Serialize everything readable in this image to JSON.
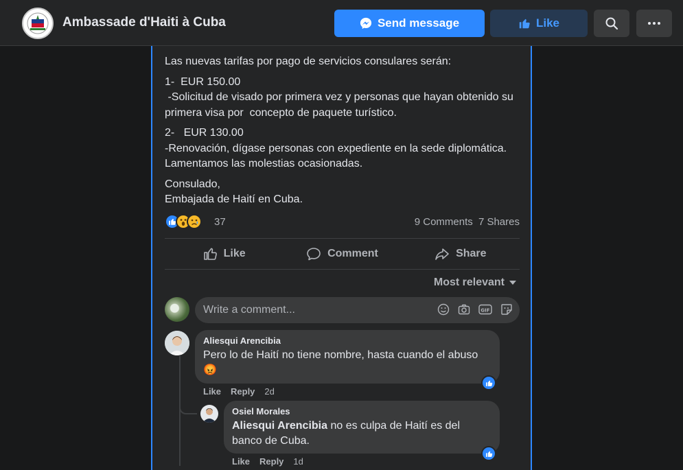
{
  "header": {
    "page_name": "Ambassade d'Haiti à Cuba",
    "send_message_label": "Send message",
    "like_label": "Like",
    "icons": [
      "messenger-icon",
      "thumbs-up-icon",
      "search-icon",
      "more-icon"
    ]
  },
  "post": {
    "paragraphs": [
      "Las nuevas tarifas por pago de servicios consulares serán:",
      "1-  EUR 150.00\n -Solicitud de visado por primera vez y personas que hayan obtenido su primera visa por  concepto de paquete turístico.",
      "2-   EUR 130.00\n-Renovación, dígase personas con expediente en la sede diplomática.\nLamentamos las molestias ocasionadas.",
      "Consulado,\nEmbajada de Haití en Cuba."
    ],
    "reaction_count": "37",
    "comments_count": "9 Comments",
    "shares_count": "7 Shares",
    "actions": {
      "like": "Like",
      "comment": "Comment",
      "share": "Share"
    }
  },
  "comments_section": {
    "sort_label": "Most relevant",
    "write_placeholder": "Write a comment...",
    "comments": [
      {
        "author": "Aliesqui Arencibia",
        "text": "Pero lo de Haití no tiene nombre, hasta cuando el abuso",
        "emoji": "😡",
        "like_label": "Like",
        "reply_label": "Reply",
        "time": "2d"
      }
    ],
    "replies": [
      {
        "author": "Osiel Morales",
        "mention": "Aliesqui Arencibia",
        "text": " no es culpa de Haití es del banco de Cuba.",
        "like_label": "Like",
        "reply_label": "Reply",
        "time": "1d"
      }
    ]
  },
  "colors": {
    "accent": "#2d88ff",
    "background": "#18191a",
    "surface": "#242526",
    "bubble": "#3a3b3c"
  }
}
